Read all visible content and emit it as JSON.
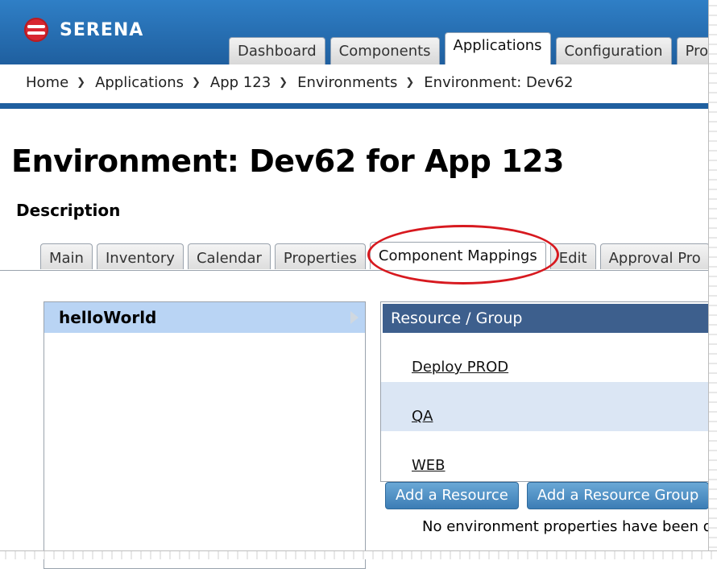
{
  "brand": {
    "name": "SERENA",
    "logo_icon": "serena-logo-icon",
    "header_color": "#1f5f9f"
  },
  "main_tabs": [
    {
      "label": "Dashboard",
      "active": false
    },
    {
      "label": "Components",
      "active": false
    },
    {
      "label": "Applications",
      "active": true
    },
    {
      "label": "Configuration",
      "active": false
    },
    {
      "label": "Proc",
      "active": false
    }
  ],
  "breadcrumb": [
    "Home",
    "Applications",
    "App 123",
    "Environments",
    "Environment: Dev62"
  ],
  "page": {
    "title": "Environment: Dev62 for App 123",
    "description_label": "Description"
  },
  "sub_tabs": [
    {
      "label": "Main",
      "active": false
    },
    {
      "label": "Inventory",
      "active": false
    },
    {
      "label": "Calendar",
      "active": false
    },
    {
      "label": "Properties",
      "active": false
    },
    {
      "label": "Component Mappings",
      "active": true
    },
    {
      "label": "Edit",
      "active": false
    },
    {
      "label": "Approval Pro",
      "active": false
    }
  ],
  "annotation": {
    "highlight_color": "#d7191f"
  },
  "components_list": [
    {
      "label": "helloWorld",
      "selected": true
    }
  ],
  "resources_panel": {
    "header": "Resource / Group",
    "rows": [
      "Deploy PROD",
      "QA",
      "WEB"
    ]
  },
  "actions": {
    "add_resource": "Add a Resource",
    "add_resource_group": "Add a Resource Group"
  },
  "empty_message": "No environment properties have been d"
}
